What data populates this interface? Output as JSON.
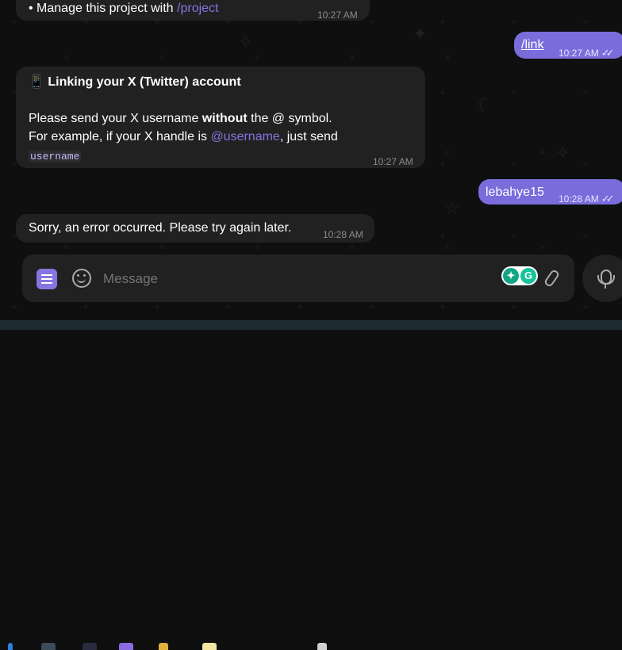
{
  "messages": {
    "m1": {
      "text_prefix": "• Manage this project with ",
      "link": "/project",
      "time": "10:27 AM"
    },
    "m2": {
      "text": "/link",
      "time": "10:27 AM",
      "ticks": "✓✓"
    },
    "m3": {
      "emoji": "📱",
      "title": "Linking your X (Twitter) account",
      "line1_a": "Please send your X username ",
      "line1_bold": "without",
      "line1_b": " the @ symbol.",
      "line2_a": "For example, if your X handle is ",
      "line2_link": "@username",
      "line2_b": ", just send",
      "code": "username",
      "time": "10:27 AM"
    },
    "m4": {
      "text": "lebahye15",
      "time": "10:28 AM",
      "ticks": "✓✓"
    },
    "m5": {
      "text": "Sorry, an error occurred. Please try again later.",
      "time": "10:28 AM"
    }
  },
  "composer": {
    "placeholder": "Message"
  },
  "colors": {
    "accent": "#8774e1",
    "outgoing": "#7b6cdc",
    "incoming": "#212121",
    "background": "#0f0f0f"
  }
}
